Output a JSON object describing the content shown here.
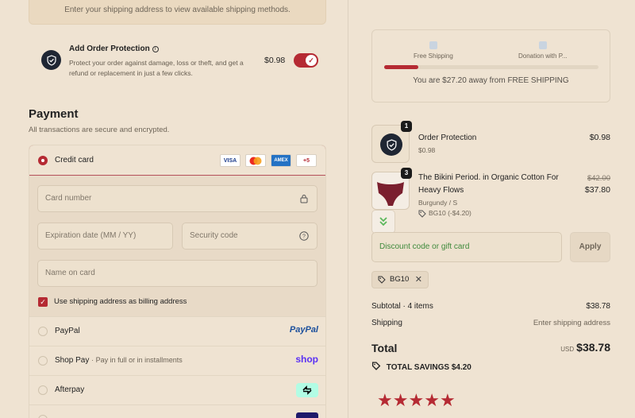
{
  "shipping_notice": "Enter your shipping address to view available shipping methods.",
  "order_protection": {
    "title": "Add Order Protection",
    "description": "Protect your order against damage, loss or theft, and get a refund or replacement in just a few clicks.",
    "price": "$0.98",
    "enabled": true
  },
  "payment": {
    "title": "Payment",
    "subtitle": "All transactions are secure and encrypted.",
    "credit_card_label": "Credit card",
    "card_brands": [
      "VISA",
      "AMEX",
      "+5"
    ],
    "fields": {
      "card_number": "Card number",
      "expiration": "Expiration date (MM / YY)",
      "security_code": "Security code",
      "name_on_card": "Name on card"
    },
    "billing_checkbox_label": "Use shipping address as billing address",
    "methods": [
      {
        "label": "PayPal",
        "logo": "PayPal"
      },
      {
        "label": "Shop Pay",
        "sub": "· Pay in full or in installments",
        "logo": "shop"
      },
      {
        "label": "Afterpay",
        "logo": "afterpay-icon"
      }
    ]
  },
  "progress": {
    "milestones": [
      "Free Shipping",
      "Donation with P..."
    ],
    "fill_fraction": 0.16,
    "message": "You are $27.20 away from FREE SHIPPING"
  },
  "items": [
    {
      "qty": "1",
      "name": "Order Protection",
      "sub": "$0.98",
      "price": "$0.98"
    },
    {
      "qty": "3",
      "name_line1": "The Bikini Period. in Organic Cotton For",
      "name_line2": "Heavy Flows",
      "variant": "Burgundy / S",
      "discount": "BG10 (-$4.20)",
      "original_price": "$42.00",
      "price": "$37.80"
    }
  ],
  "discount": {
    "placeholder": "Discount code or gift card",
    "apply_label": "Apply",
    "applied_code": "BG10"
  },
  "summary": {
    "subtotal_label": "Subtotal · 4 items",
    "subtotal_value": "$38.78",
    "shipping_label": "Shipping",
    "shipping_value": "Enter shipping address",
    "total_label": "Total",
    "currency": "USD",
    "total_value": "$38.78",
    "savings_label": "TOTAL SAVINGS",
    "savings_value": "$4.20"
  },
  "rating": {
    "stars": 5
  },
  "colors": {
    "accent": "#b52a33",
    "background": "#efe3d2",
    "badge": "#1f2633"
  }
}
